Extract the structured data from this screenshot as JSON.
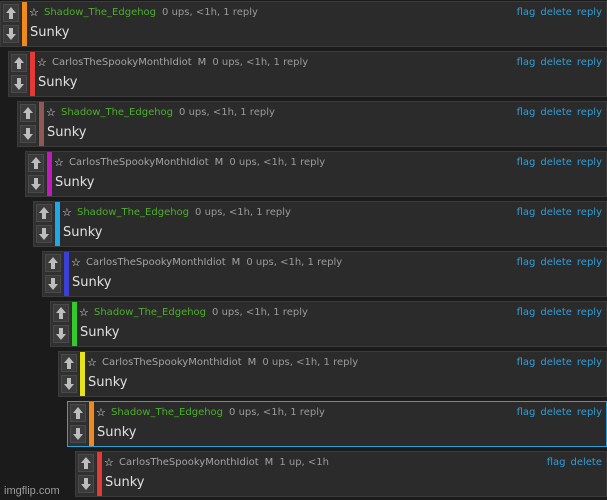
{
  "comments": [
    {
      "username": "Shadow_The_Edgehog",
      "mod": "",
      "stats": "0 ups, <1h, 1 reply",
      "body": "Sunky",
      "bar_color": "#f08a1c",
      "user_color": "green",
      "actions": [
        "flag",
        "delete",
        "reply"
      ]
    },
    {
      "username": "CarlosTheSpookyMonthIdiot",
      "mod": "M",
      "stats": "0 ups, <1h, 1 reply",
      "body": "Sunky",
      "bar_color": "#e53935",
      "user_color": "gray",
      "actions": [
        "flag",
        "delete",
        "reply"
      ]
    },
    {
      "username": "Shadow_The_Edgehog",
      "mod": "",
      "stats": "0 ups, <1h, 1 reply",
      "body": "Sunky",
      "bar_color": "#8d5a57",
      "user_color": "green",
      "actions": [
        "flag",
        "delete",
        "reply"
      ]
    },
    {
      "username": "CarlosTheSpookyMonthIdiot",
      "mod": "M",
      "stats": "0 ups, <1h, 1 reply",
      "body": "Sunky",
      "bar_color": "#c01bbd",
      "user_color": "gray",
      "actions": [
        "flag",
        "delete",
        "reply"
      ]
    },
    {
      "username": "Shadow_The_Edgehog",
      "mod": "",
      "stats": "0 ups, <1h, 1 reply",
      "body": "Sunky",
      "bar_color": "#1fa7e8",
      "user_color": "green",
      "actions": [
        "flag",
        "delete",
        "reply"
      ]
    },
    {
      "username": "CarlosTheSpookyMonthIdiot",
      "mod": "M",
      "stats": "0 ups, <1h, 1 reply",
      "body": "Sunky",
      "bar_color": "#3a3fd6",
      "user_color": "gray",
      "actions": [
        "flag",
        "delete",
        "reply"
      ]
    },
    {
      "username": "Shadow_The_Edgehog",
      "mod": "",
      "stats": "0 ups, <1h, 1 reply",
      "body": "Sunky",
      "bar_color": "#34c92e",
      "user_color": "green",
      "actions": [
        "flag",
        "delete",
        "reply"
      ]
    },
    {
      "username": "CarlosTheSpookyMonthIdiot",
      "mod": "M",
      "stats": "0 ups, <1h, 1 reply",
      "body": "Sunky",
      "bar_color": "#e8e21a",
      "user_color": "gray",
      "actions": [
        "flag",
        "delete",
        "reply"
      ]
    },
    {
      "username": "Shadow_The_Edgehog",
      "mod": "",
      "stats": "0 ups, <1h, 1 reply",
      "body": "Sunky",
      "bar_color": "#f08a1c",
      "user_color": "green",
      "actions": [
        "flag",
        "delete",
        "reply"
      ]
    },
    {
      "username": "CarlosTheSpookyMonthIdiot",
      "mod": "M",
      "stats": "1 up, <1h",
      "body": "Sunky",
      "bar_color": "#e53935",
      "user_color": "gray",
      "actions": [
        "flag",
        "delete"
      ]
    }
  ],
  "highlighted_index": 8,
  "watermark": "imgflip.com"
}
